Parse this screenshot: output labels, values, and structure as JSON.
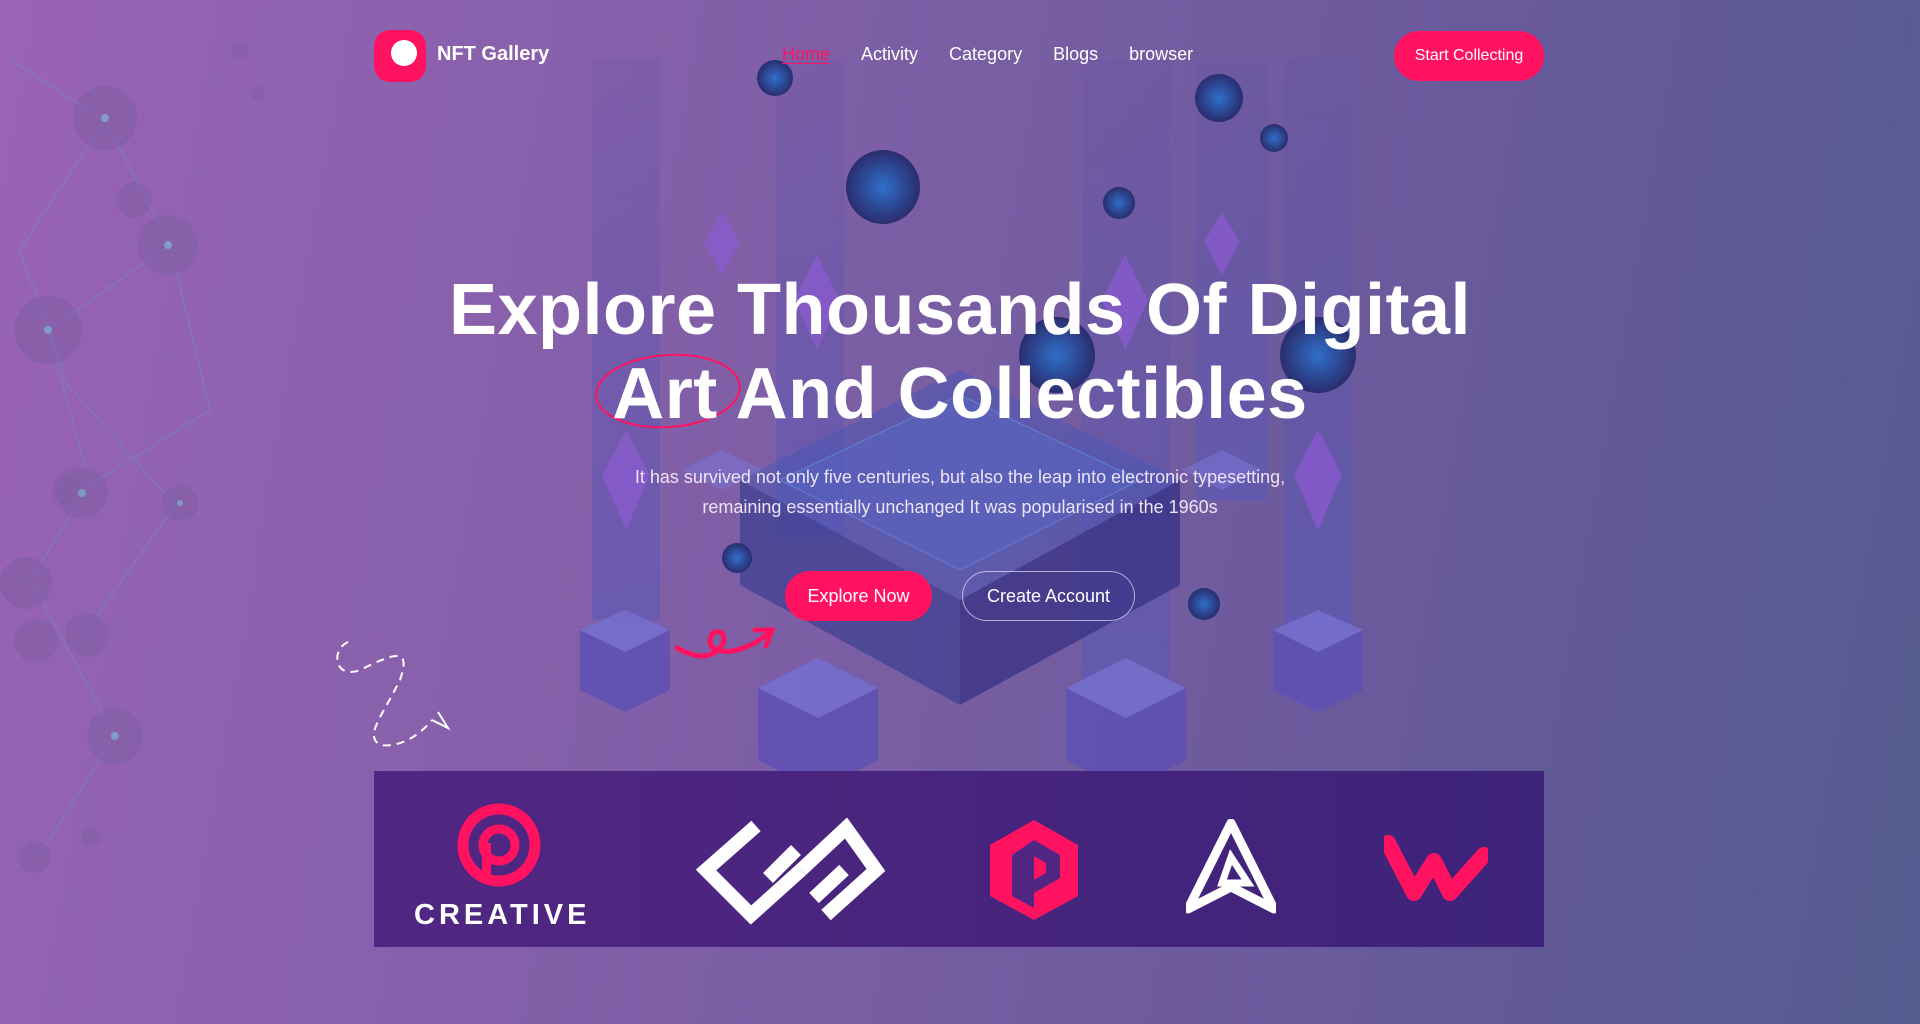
{
  "brand": {
    "name": "NFT Gallery",
    "accent": "#ff1361"
  },
  "nav": {
    "items": [
      "Home",
      "Activity",
      "Category",
      "Blogs",
      "browser"
    ],
    "active": "Home"
  },
  "header": {
    "cta_label": "Start Collecting"
  },
  "hero": {
    "title_line1": "Explore Thousands Of Digital",
    "title_highlight": "Art",
    "title_line2_rest": " And Collectibles",
    "subtitle_line1": "It has survived not only five centuries, but also the leap into electronic typesetting,",
    "subtitle_line2": "remaining essentially unchanged It was popularised in the 1960s",
    "primary_cta": "Explore Now",
    "secondary_cta": "Create Account"
  },
  "partners": {
    "creative_label": "CREATIVE",
    "logos": [
      "creative-logo",
      "wm-logo",
      "p-hex-logo",
      "a-triangle-logo",
      "w-logo"
    ]
  }
}
